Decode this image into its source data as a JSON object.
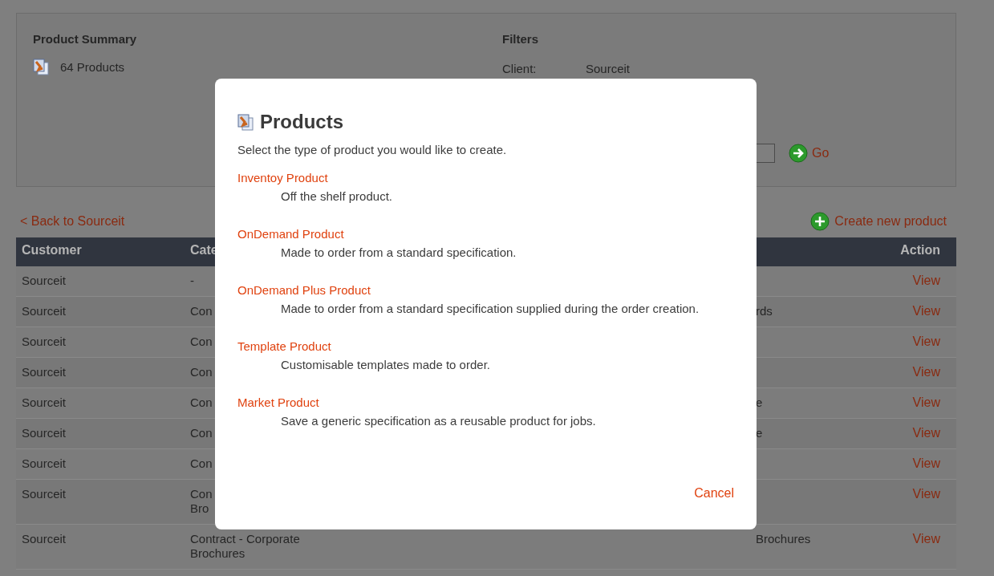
{
  "summary": {
    "title": "Product Summary",
    "count": "64 Products"
  },
  "filters": {
    "title": "Filters",
    "client_label": "Client:",
    "client_value": "Sourceit",
    "go": "Go"
  },
  "back_link": "< Back to Sourceit",
  "create_link": "Create new product",
  "table": {
    "columns": [
      "Customer",
      "Cate",
      "Action"
    ],
    "rows": [
      {
        "customer": "Sourceit",
        "category": [
          "-"
        ],
        "action": "View"
      },
      {
        "customer": "Sourceit",
        "category": [
          "Con"
        ],
        "column_4": "rds",
        "action": "View"
      },
      {
        "customer": "Sourceit",
        "category": [
          "Con"
        ],
        "action": "View"
      },
      {
        "customer": "Sourceit",
        "category": [
          "Con"
        ],
        "action": "View"
      },
      {
        "customer": "Sourceit",
        "category": [
          "Con"
        ],
        "column_4": "e",
        "action": "View"
      },
      {
        "customer": "Sourceit",
        "category": [
          "Con"
        ],
        "column_4": "e",
        "action": "View"
      },
      {
        "customer": "Sourceit",
        "category": [
          "Con"
        ],
        "action": "View"
      },
      {
        "customer": "Sourceit",
        "category": [
          "Con",
          "Bro"
        ],
        "action": "View"
      },
      {
        "customer": "Sourceit",
        "category": [
          "Contract - Corporate",
          "Brochures"
        ],
        "column_4": "Brochures",
        "action": "View"
      }
    ]
  },
  "dialog": {
    "title": "Products",
    "intro": "Select the type of product you would like to create.",
    "options": [
      {
        "label": "Inventoy Product",
        "description": "Off the shelf product."
      },
      {
        "label": "OnDemand Product",
        "description": "Made to order from a standard specification."
      },
      {
        "label": "OnDemand Plus Product",
        "description": "Made to order from a standard specification supplied during the order creation."
      },
      {
        "label": "Template Product",
        "description": "Customisable templates made to order."
      },
      {
        "label": "Market Product",
        "description": "Save a generic specification as a reusable product for jobs."
      }
    ],
    "cancel": "Cancel"
  }
}
